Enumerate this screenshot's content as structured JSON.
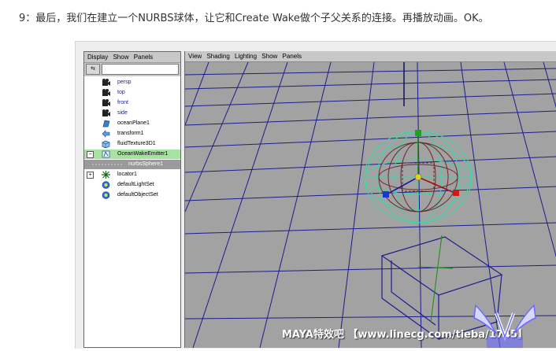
{
  "caption": "9：最后，我们在建立一个NURBS球体，让它和Create Wake做个子父关系的连接。再播放动画。OK。",
  "outliner": {
    "menu": [
      "Display",
      "Show",
      "Panels"
    ],
    "items": [
      {
        "label": "persp",
        "icon": "camera-icon",
        "style": "camera"
      },
      {
        "label": "top",
        "icon": "camera-icon",
        "style": "camera"
      },
      {
        "label": "front",
        "icon": "camera-icon",
        "style": "camera"
      },
      {
        "label": "side",
        "icon": "camera-icon",
        "style": "camera"
      },
      {
        "label": "oceanPlane1",
        "icon": "ocean-plane-icon",
        "style": "normal"
      },
      {
        "label": "transform1",
        "icon": "transform-icon",
        "style": "normal"
      },
      {
        "label": "fluidTexture3D1",
        "icon": "fluid-container-icon",
        "style": "normal"
      },
      {
        "label": "OceanWakeEmitter1",
        "icon": "emitter-icon",
        "style": "selected"
      },
      {
        "label": "nurbsSphere1",
        "icon": "",
        "style": "child"
      },
      {
        "label": "locator1",
        "icon": "locator-icon",
        "style": "normal"
      },
      {
        "label": "defaultLightSet",
        "icon": "set-icon",
        "style": "normal"
      },
      {
        "label": "defaultObjectSet",
        "icon": "set-icon",
        "style": "normal"
      }
    ]
  },
  "viewport": {
    "menu": [
      "View",
      "Shading",
      "Lighting",
      "Show",
      "Panels"
    ]
  },
  "watermark": "MAYA特效吧 【www.linecg.com/tieba/1745】",
  "colors": {
    "grid": "#1c1c8c",
    "wake_emitter": "#3cd6a8",
    "sphere": "#6b2a2a",
    "selection": "#a6e3a0"
  }
}
